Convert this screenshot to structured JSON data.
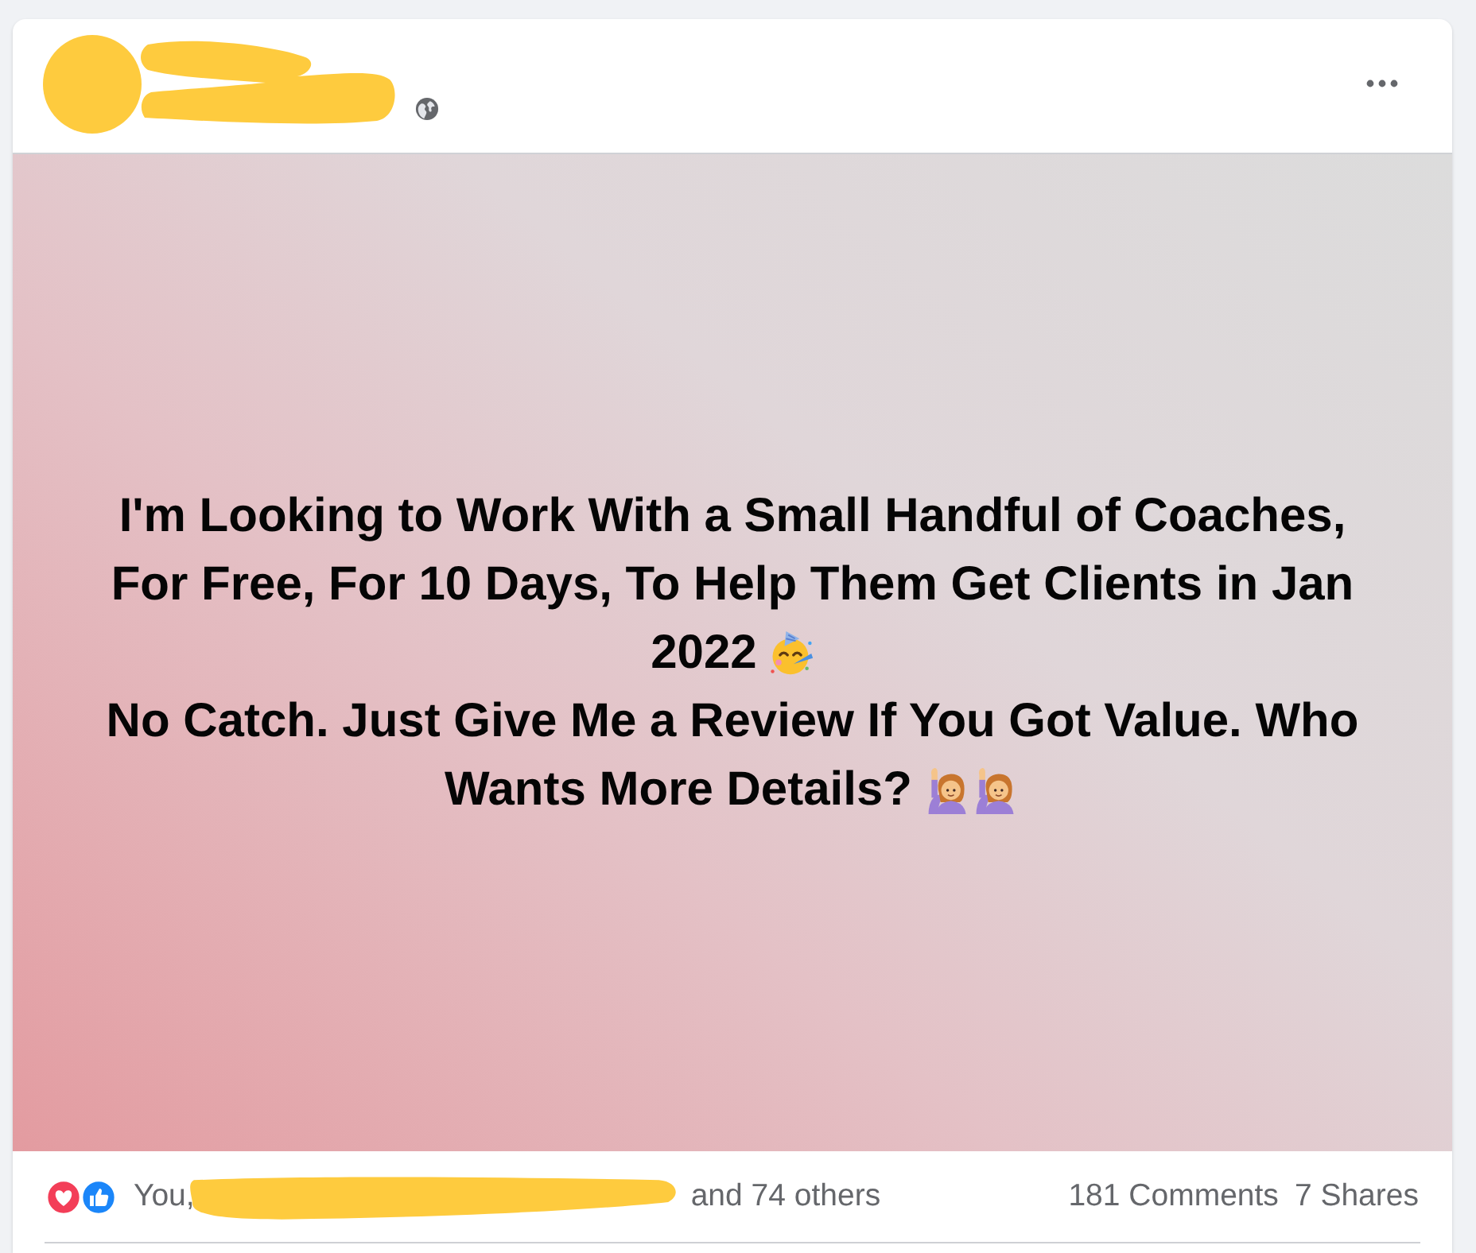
{
  "post": {
    "lines": [
      "I'm Looking to Work With a Small Handful of Coaches,",
      "For Free, For 10 Days, To Help Them Get Clients in Jan",
      "2022",
      "No Catch. Just Give Me a Review If You Got Value. Who",
      "Wants More Details?"
    ]
  },
  "footer": {
    "reactions_start": "You,",
    "reactions_end": "and 74 others",
    "comments": "181 Comments",
    "shares": "7 Shares"
  }
}
